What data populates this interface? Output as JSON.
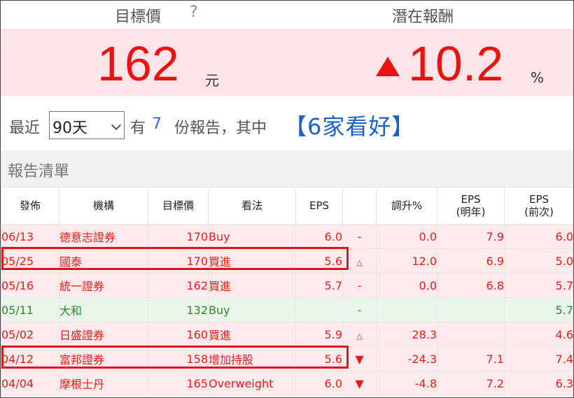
{
  "header": {
    "target_title": "目標價",
    "help_mark": "?",
    "reward_title": "潛在報酬"
  },
  "summary": {
    "price": "162",
    "price_unit": "元",
    "reward": "10.2",
    "reward_unit": "%"
  },
  "filter": {
    "prefix": "最近",
    "period": "90天",
    "have": "有",
    "count": "7",
    "suffix": "份報告，其中",
    "bullish": "【6家看好】"
  },
  "section": {
    "title": "報告清單"
  },
  "columns": {
    "date": "發佈",
    "org": "機構",
    "tp": "目標價",
    "view": "看法",
    "eps": "EPS",
    "chg": "調升%",
    "eps_next1": "EPS",
    "eps_next1_sub": "(明年)",
    "eps_next2": "EPS",
    "eps_next2_sub": "(前次)"
  },
  "rows": [
    {
      "date": "06/13",
      "org": "德意志證券",
      "tp": "170",
      "view": "Buy",
      "eps": "6.0",
      "sig": "-",
      "chg": "0.0",
      "e1": "7.9",
      "e2": "6.0",
      "tone": "up"
    },
    {
      "date": "05/25",
      "org": "國泰",
      "tp": "170",
      "view": "買進",
      "eps": "5.6",
      "sig": "△",
      "chg": "12.0",
      "e1": "6.9",
      "e2": "5.0",
      "tone": "up"
    },
    {
      "date": "05/16",
      "org": "統一證券",
      "tp": "162",
      "view": "買進",
      "eps": "5.7",
      "sig": "-",
      "chg": "0.0",
      "e1": "6.8",
      "e2": "5.7",
      "tone": "up"
    },
    {
      "date": "05/11",
      "org": "大和",
      "tp": "132",
      "view": "Buy",
      "eps": "",
      "sig": "-",
      "chg": "",
      "e1": "",
      "e2": "5.7",
      "tone": "neu"
    },
    {
      "date": "05/02",
      "org": "日盛證券",
      "tp": "160",
      "view": "買進",
      "eps": "5.9",
      "sig": "△",
      "chg": "28.3",
      "e1": "",
      "e2": "4.6",
      "tone": "up"
    },
    {
      "date": "04/12",
      "org": "富邦證券",
      "tp": "158",
      "view": "增加持股",
      "eps": "5.6",
      "sig": "▼",
      "chg": "-24.3",
      "e1": "7.1",
      "e2": "7.4",
      "tone": "up"
    },
    {
      "date": "04/04",
      "org": "摩根士丹",
      "tp": "165",
      "view": "Overweight",
      "eps": "6.0",
      "sig": "▼",
      "chg": "-4.8",
      "e1": "7.2",
      "e2": "6.3",
      "tone": "up"
    }
  ]
}
